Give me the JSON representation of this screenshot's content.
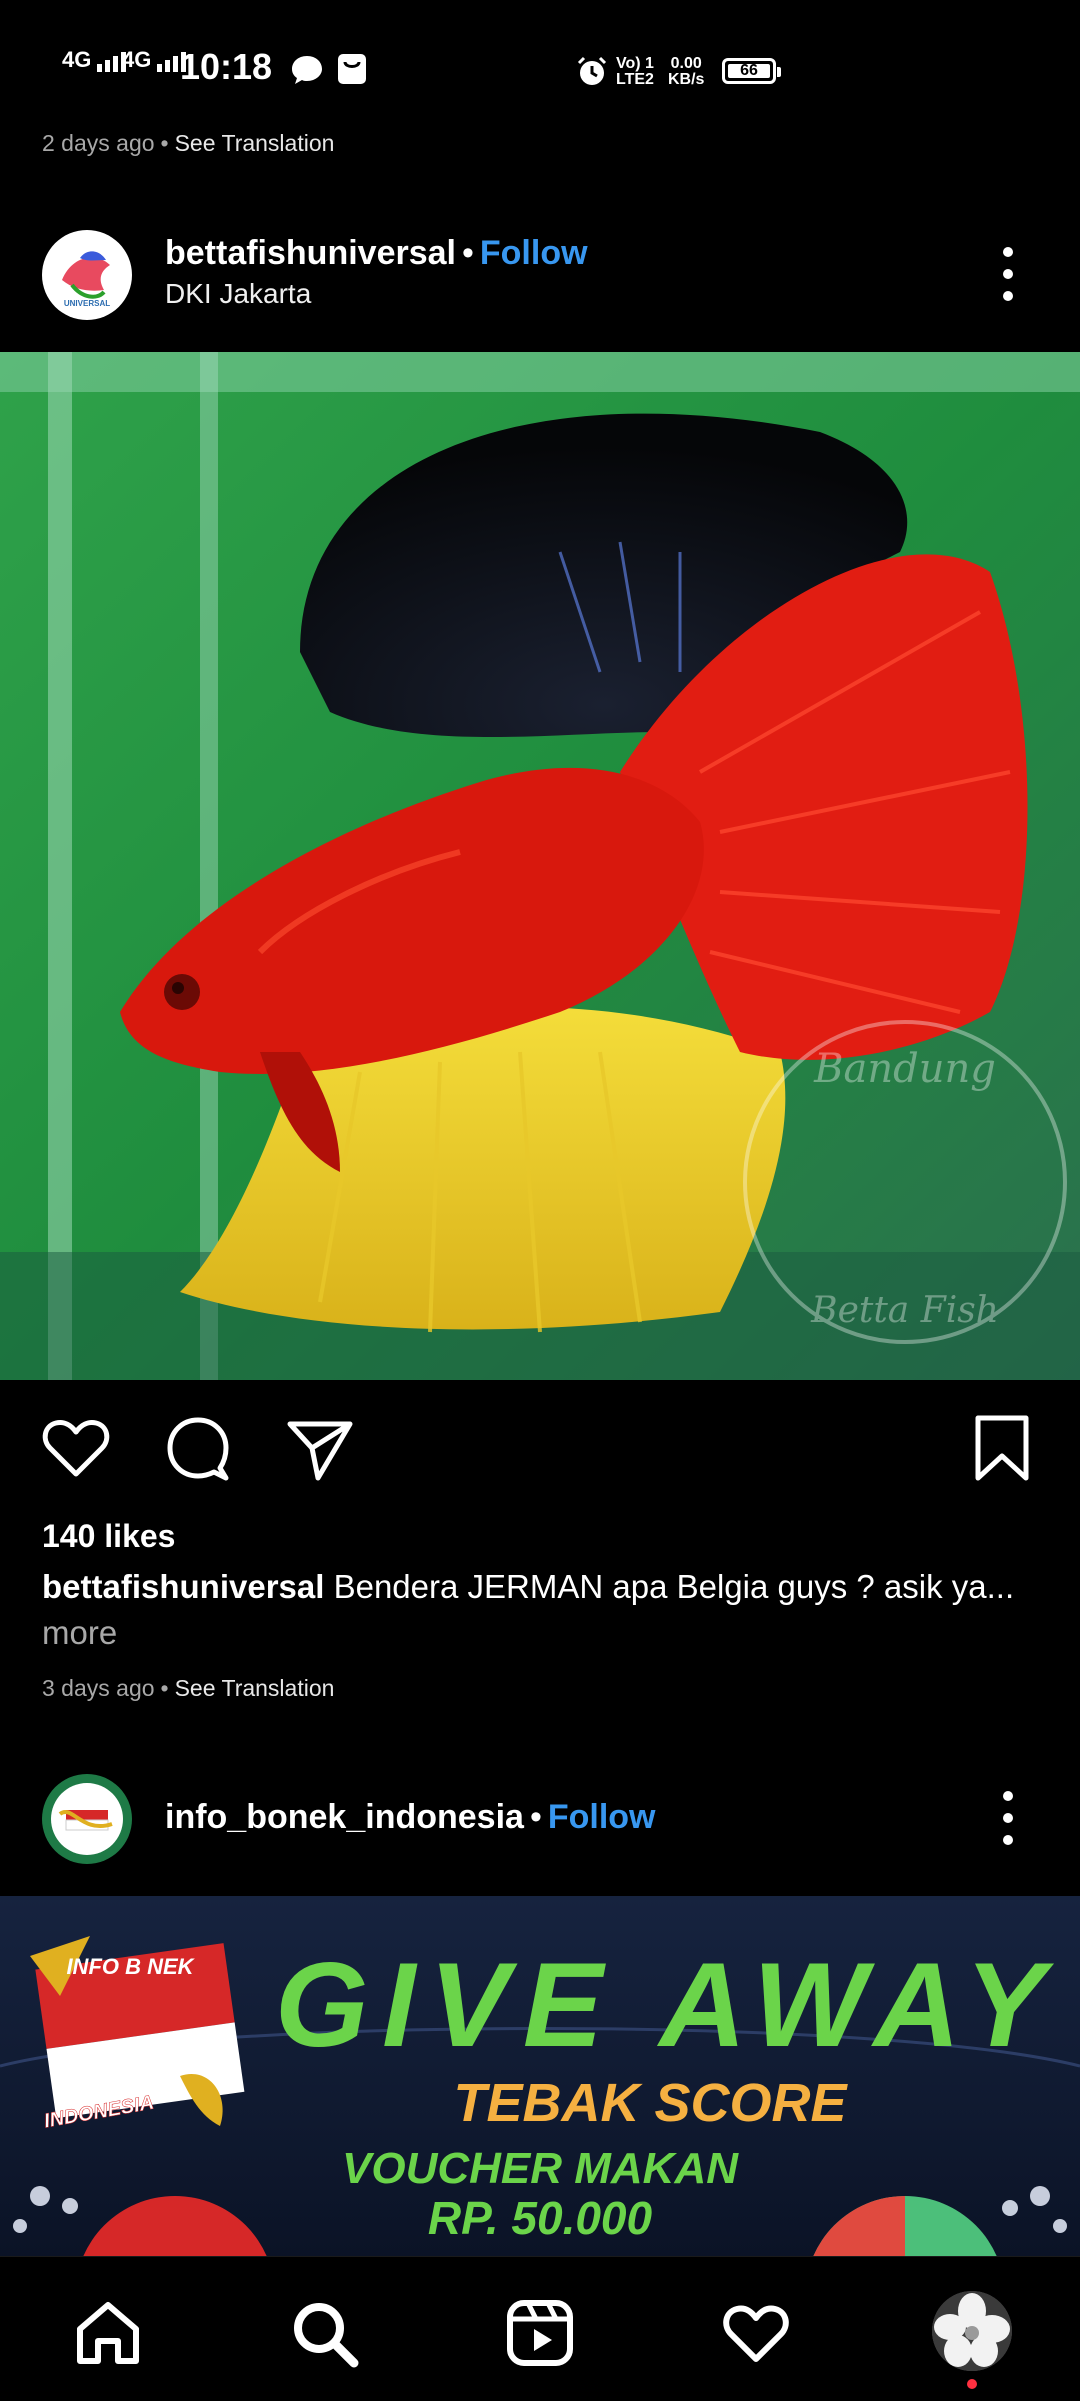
{
  "status_bar": {
    "network_1": "4G",
    "network_2": "4G",
    "time": "10:18",
    "volte_line1": "Vo) 1",
    "volte_line2": "LTE2",
    "speed_value": "0.00",
    "speed_unit": "KB/s",
    "battery": "66"
  },
  "prev_post": {
    "time_ago": "2 days ago",
    "separator": "•",
    "see_translation": "See Translation"
  },
  "post1": {
    "username": "bettafishuniversal",
    "separator": "•",
    "follow_label": "Follow",
    "location": "DKI Jakarta",
    "image_label": "betta fish photo",
    "likes": "140 likes",
    "caption_user": "bettafishuniversal",
    "caption_text": "Bendera JERMAN apa Belgia guys ? asik ya...",
    "caption_more": "more",
    "time_ago": "3 days ago",
    "see_translation": "See Translation",
    "watermark_top": "Bandung",
    "watermark_bottom": "Betta Fish"
  },
  "post2": {
    "username": "info_bonek_indonesia",
    "separator": "•",
    "follow_label": "Follow",
    "logo_text_top": "INFO B NEK",
    "logo_text_bottom": "INDONESIA",
    "banner_title": "GIVE AWAY",
    "banner_subtitle": "TEBAK SCORE",
    "banner_voucher": "VOUCHER MAKAN",
    "banner_amount": "RP. 50.000"
  },
  "nav": {
    "items": [
      "home-icon",
      "search-icon",
      "reels-icon",
      "activity-heart-icon",
      "profile-avatar"
    ]
  },
  "colors": {
    "follow_blue": "#3897f0",
    "notification_red": "#ff3040",
    "banner_green": "#6bd44a",
    "banner_orange": "#f5b041"
  }
}
